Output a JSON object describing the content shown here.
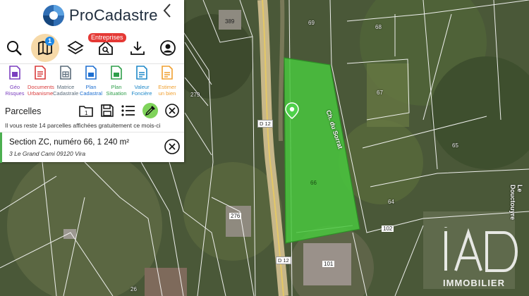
{
  "app": {
    "name": "ProCadastre",
    "back_icon": "chevron-left-icon"
  },
  "toolbar": {
    "tools": [
      {
        "name": "search-icon"
      },
      {
        "name": "map-icon",
        "badge": "1"
      },
      {
        "name": "layers-icon"
      },
      {
        "name": "entreprises-house-icon",
        "tag": "Entreprises"
      },
      {
        "name": "download-icon"
      },
      {
        "name": "account-icon"
      }
    ]
  },
  "documents": [
    {
      "line1": "Géo",
      "line2": "Risques",
      "color": "#7b3fbf"
    },
    {
      "line1": "Documents",
      "line2": "Urbanisme",
      "color": "#d93a3a"
    },
    {
      "line1": "Matrice",
      "line2": "Cadastrale",
      "color": "#5a6b7a"
    },
    {
      "line1": "Plan",
      "line2": "Cadastral",
      "color": "#1e6fd0"
    },
    {
      "line1": "Plan",
      "line2": "Situation",
      "color": "#2e9e4a"
    },
    {
      "line1": "Valeur",
      "line2": "Foncière",
      "color": "#1e88c8"
    },
    {
      "line1": "Estimer",
      "line2": "un bien",
      "color": "#f0a030"
    }
  ],
  "parcels": {
    "title": "Parcelles",
    "quota_text": "Il vous reste 14 parcelles affichées gratuitement ce mois-ci",
    "selected": {
      "title": "Section ZC, numéro 66, 1 240 m²",
      "address": "3 Le Grand Cami 09120 Vira"
    }
  },
  "map": {
    "parcel_numbers": [
      "389",
      "69",
      "68",
      "67",
      "65",
      "64",
      "102",
      "66",
      "279",
      "276",
      "101",
      "26"
    ],
    "road_tags": [
      "D 12",
      "D 12"
    ],
    "street_names": [
      "Ch. du Sorrat",
      "Le Douctouyre"
    ],
    "highlight_color": "#49c73e"
  },
  "watermark": {
    "logo": "iAD",
    "sub": "IMMOBILIER"
  }
}
